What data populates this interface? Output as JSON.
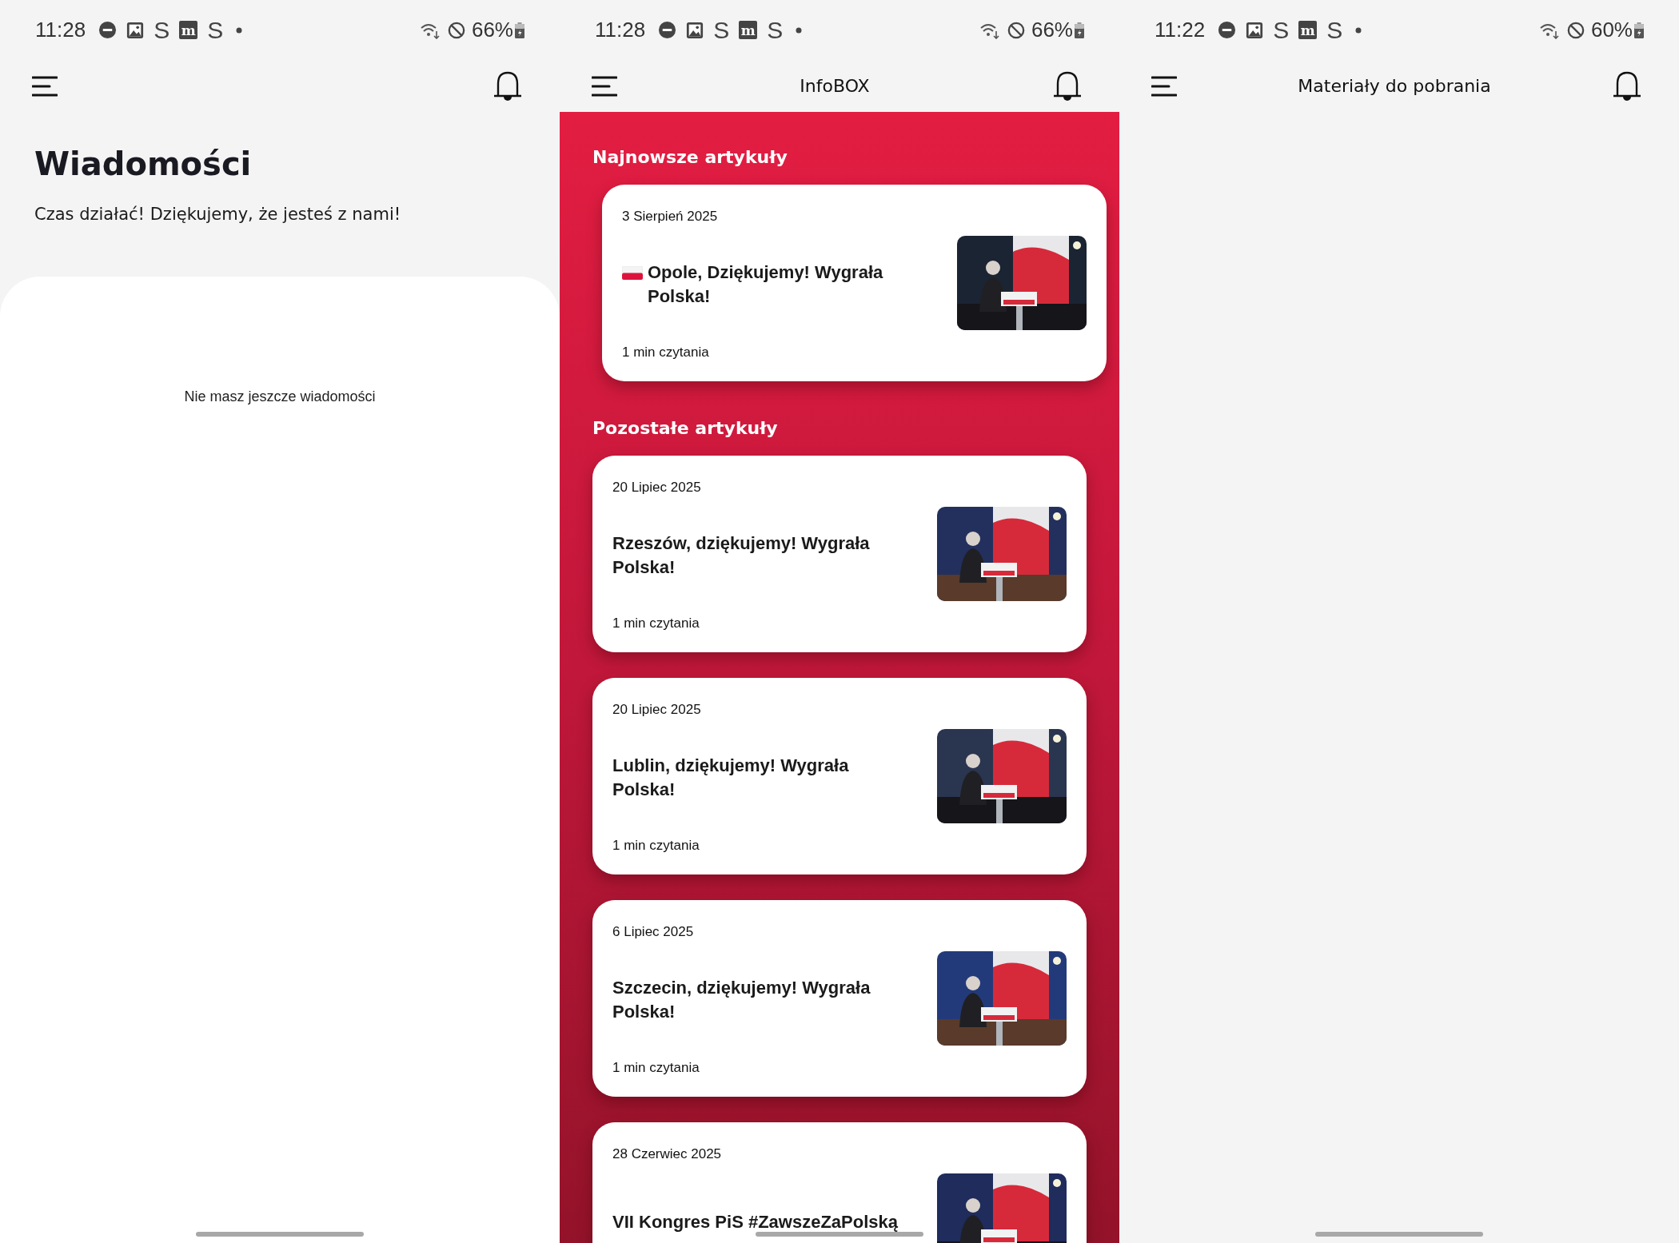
{
  "screens": [
    {
      "kind": "messages",
      "status_bar": {
        "time": "11:28",
        "battery": "66%",
        "notification_icons": [
          {
            "kind": "dnd"
          },
          {
            "kind": "gallery"
          },
          {
            "kind": "letter",
            "text": "S"
          },
          {
            "kind": "tile",
            "text": "m"
          },
          {
            "kind": "letter",
            "text": "S"
          },
          {
            "kind": "dot"
          }
        ]
      },
      "title": "Wiadomości",
      "subtitle": "Czas działać! Dziękujemy, że jesteś z nami!",
      "empty_message": "Nie masz jeszcze wiadomości"
    },
    {
      "kind": "articles",
      "status_bar": {
        "time": "11:28",
        "battery": "66%",
        "notification_icons": [
          {
            "kind": "dnd"
          },
          {
            "kind": "gallery"
          },
          {
            "kind": "letter",
            "text": "S"
          },
          {
            "kind": "tile",
            "text": "m"
          },
          {
            "kind": "letter",
            "text": "S"
          },
          {
            "kind": "dot"
          }
        ]
      },
      "header_title": "InfoBOX",
      "sections": [
        {
          "heading": "Najnowsze artykuły",
          "featured": true,
          "articles": [
            {
              "date": "3 Sierpień 2025",
              "title": "Opole, Dziękujemy! Wygrała Polska!",
              "flag": true,
              "read_time": "1 min czytania"
            }
          ]
        },
        {
          "heading": "Pozostałe artykuły",
          "featured": false,
          "articles": [
            {
              "date": "20 Lipiec 2025",
              "title": "Rzeszów, dziękujemy! Wygrała Polska!",
              "flag": false,
              "read_time": "1 min czytania"
            },
            {
              "date": "20 Lipiec 2025",
              "title": "Lublin, dziękujemy! Wygrała Polska!",
              "flag": false,
              "read_time": "1 min czytania"
            },
            {
              "date": "6 Lipiec 2025",
              "title": "Szczecin, dziękujemy! Wygrała Polska!",
              "flag": false,
              "read_time": "1 min czytania"
            },
            {
              "date": "28 Czerwiec 2025",
              "title": "VII Kongres PiS #ZawszeZaPolską",
              "flag": false
            }
          ]
        }
      ]
    },
    {
      "kind": "downloads",
      "status_bar": {
        "time": "11:22",
        "battery": "60%",
        "notification_icons": [
          {
            "kind": "dnd"
          },
          {
            "kind": "gallery"
          },
          {
            "kind": "letter",
            "text": "S"
          },
          {
            "kind": "tile",
            "text": "m"
          },
          {
            "kind": "letter",
            "text": "S"
          },
          {
            "kind": "dot"
          }
        ]
      },
      "header_title": "Materiały do pobrania"
    }
  ]
}
